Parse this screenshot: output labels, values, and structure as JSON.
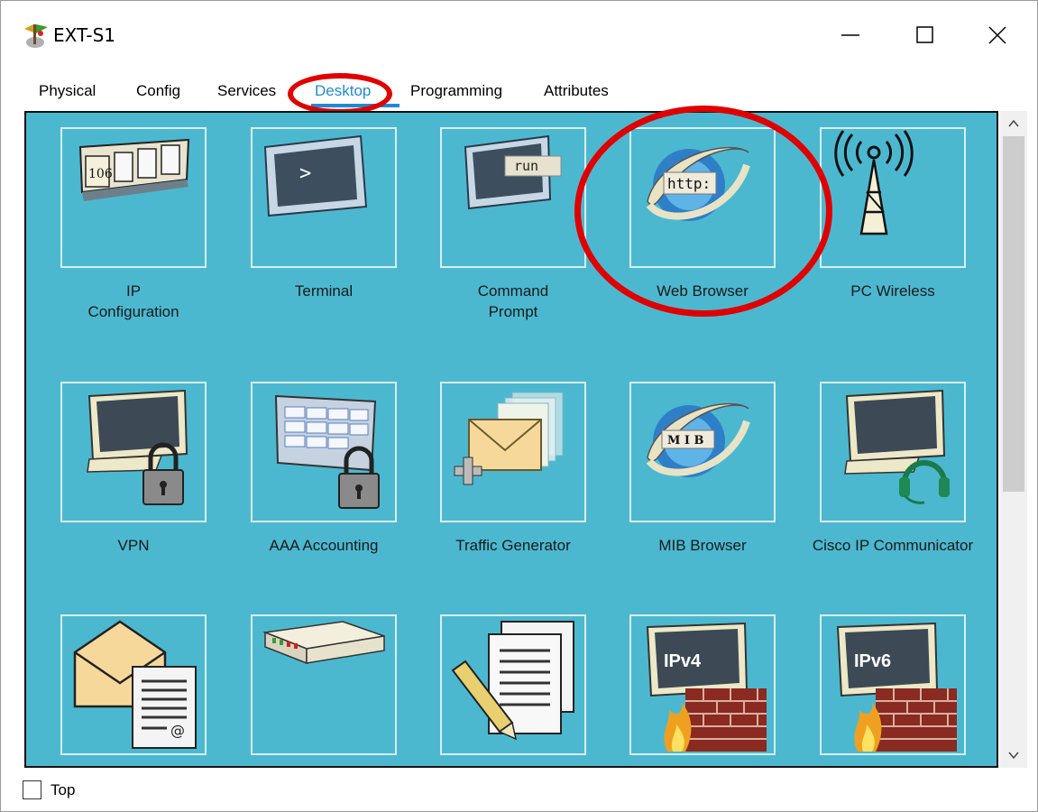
{
  "window": {
    "title": "EXT-S1",
    "minimize_icon": "minimize-icon",
    "maximize_icon": "maximize-icon",
    "close_icon": "close-icon"
  },
  "tabs": [
    {
      "label": "Physical",
      "active": false
    },
    {
      "label": "Config",
      "active": false
    },
    {
      "label": "Services",
      "active": false
    },
    {
      "label": "Desktop",
      "active": true
    },
    {
      "label": "Programming",
      "active": false
    },
    {
      "label": "Attributes",
      "active": false
    }
  ],
  "desktop_apps": [
    {
      "label_lines": [
        "IP",
        "Configuration"
      ],
      "icon": "ip-configuration-icon"
    },
    {
      "label_lines": [
        "Terminal"
      ],
      "icon": "terminal-icon",
      "icon_text": ">"
    },
    {
      "label_lines": [
        "Command",
        "Prompt"
      ],
      "icon": "command-prompt-icon",
      "icon_text": "run"
    },
    {
      "label_lines": [
        "Web Browser"
      ],
      "icon": "web-browser-icon",
      "icon_text": "http:"
    },
    {
      "label_lines": [
        "PC Wireless"
      ],
      "icon": "pc-wireless-icon"
    },
    {
      "label_lines": [
        "VPN"
      ],
      "icon": "vpn-icon"
    },
    {
      "label_lines": [
        "AAA Accounting"
      ],
      "icon": "aaa-accounting-icon"
    },
    {
      "label_lines": [
        "Traffic Generator"
      ],
      "icon": "traffic-generator-icon"
    },
    {
      "label_lines": [
        "MIB Browser"
      ],
      "icon": "mib-browser-icon",
      "icon_text": "M I B"
    },
    {
      "label_lines": [
        "Cisco IP Communicator"
      ],
      "icon": "cisco-ip-communicator-icon"
    },
    {
      "label_lines": [
        ""
      ],
      "icon": "email-icon"
    },
    {
      "label_lines": [
        ""
      ],
      "icon": "pppoe-dialer-icon"
    },
    {
      "label_lines": [
        ""
      ],
      "icon": "text-editor-icon"
    },
    {
      "label_lines": [
        ""
      ],
      "icon": "ipv4-firewall-icon",
      "icon_text": "IPv4"
    },
    {
      "label_lines": [
        ""
      ],
      "icon": "ipv6-firewall-icon",
      "icon_text": "IPv6"
    }
  ],
  "ip_config_display": "106",
  "footer": {
    "checkbox_label": "Top",
    "checked": false
  },
  "colors": {
    "desktop_bg": "#4cb8d0",
    "active_tab": "#1f8ad3",
    "highlight_annotation": "#e00000"
  },
  "annotations": [
    "desktop-tab-highlight",
    "web-browser-highlight"
  ]
}
